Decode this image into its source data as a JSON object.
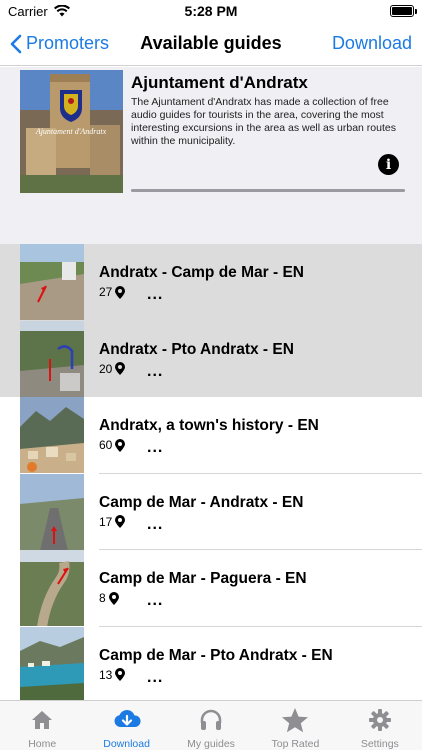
{
  "status_bar": {
    "carrier": "Carrier",
    "time": "5:28 PM"
  },
  "nav": {
    "back_label": "Promoters",
    "title": "Available guides",
    "action_label": "Download"
  },
  "promoter": {
    "name": "Ajuntament d'Andratx",
    "description": "The Ajuntament d'Andratx has made a collection of free audio guides for tourists in the area, covering the most interesting excursions in the area as well as urban routes within the municipality.",
    "image_caption": "Ajuntament d'Andratx"
  },
  "guides": [
    {
      "name": "Andratx - Camp de Mar - EN",
      "stops": "27",
      "more": "...",
      "highlighted": true
    },
    {
      "name": "Andratx - Pto Andratx - EN",
      "stops": "20",
      "more": "...",
      "highlighted": true
    },
    {
      "name": "Andratx, a town's history - EN",
      "stops": "60",
      "more": "...",
      "highlighted": false
    },
    {
      "name": "Camp de Mar - Andratx - EN",
      "stops": "17",
      "more": "...",
      "highlighted": false
    },
    {
      "name": "Camp de Mar - Paguera - EN",
      "stops": "8",
      "more": "...",
      "highlighted": false
    },
    {
      "name": "Camp de Mar - Pto Andratx - EN",
      "stops": "13",
      "more": "...",
      "highlighted": false
    }
  ],
  "tabs": [
    {
      "label": "Home",
      "icon": "home-icon"
    },
    {
      "label": "Download",
      "icon": "cloud-download-icon",
      "active": true
    },
    {
      "label": "My guides",
      "icon": "headphones-icon"
    },
    {
      "label": "Top Rated",
      "icon": "star-icon"
    },
    {
      "label": "Settings",
      "icon": "gear-icon"
    }
  ],
  "colors": {
    "accent": "#1c7be3",
    "highlight_row": "#dcdcdc",
    "header_bg": "#efeff4"
  }
}
